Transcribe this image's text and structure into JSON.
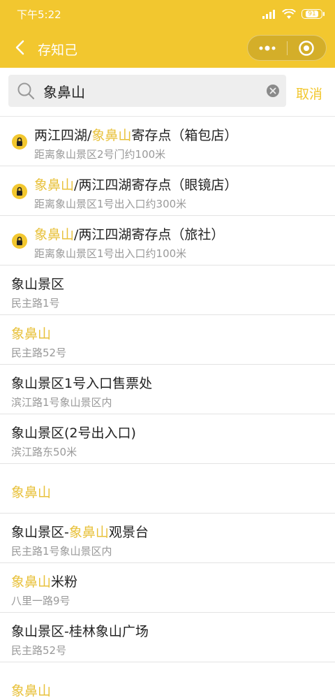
{
  "status_bar": {
    "time": "下午5:22",
    "battery": "91"
  },
  "nav": {
    "title": "存知己"
  },
  "search": {
    "value": "象鼻山",
    "cancel_label": "取消"
  },
  "colors": {
    "accent": "#f2c72f",
    "highlight": "#e8c13a",
    "subtext": "#999999"
  },
  "results": [
    {
      "type": "storage",
      "pre": "两江四湖/",
      "hl": "象鼻山",
      "post": "寄存点（箱包店）",
      "sub": "距离象山景区2号门约100米"
    },
    {
      "type": "storage",
      "pre": "",
      "hl": "象鼻山",
      "post": "/两江四湖寄存点（眼镜店）",
      "sub": "距离象山景区1号出入口约300米"
    },
    {
      "type": "storage",
      "pre": "",
      "hl": "象鼻山",
      "post": "/两江四湖寄存点（旅社）",
      "sub": "距离象山景区1号出入口约100米"
    },
    {
      "type": "place",
      "pre": "象山景区",
      "hl": "",
      "post": "",
      "sub": "民主路1号"
    },
    {
      "type": "place",
      "pre": "",
      "hl": "象鼻山",
      "post": "",
      "sub": "民主路52号"
    },
    {
      "type": "place",
      "pre": "象山景区1号入口售票处",
      "hl": "",
      "post": "",
      "sub": "滨江路1号象山景区内"
    },
    {
      "type": "place",
      "pre": "象山景区(2号出入口)",
      "hl": "",
      "post": "",
      "sub": "滨江路东50米"
    },
    {
      "type": "single",
      "pre": "",
      "hl": "象鼻山",
      "post": "",
      "sub": ""
    },
    {
      "type": "place",
      "pre": "象山景区-",
      "hl": "象鼻山",
      "post": "观景台",
      "sub": "民主路1号象山景区内"
    },
    {
      "type": "place",
      "pre": "",
      "hl": "象鼻山",
      "post": "米粉",
      "sub": "八里一路9号"
    },
    {
      "type": "place",
      "pre": "象山景区-桂林象山广场",
      "hl": "",
      "post": "",
      "sub": "民主路52号"
    },
    {
      "type": "single",
      "pre": "",
      "hl": "象鼻山",
      "post": "",
      "sub": ""
    }
  ]
}
